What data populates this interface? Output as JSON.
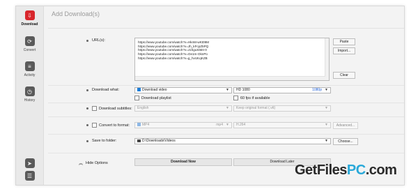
{
  "title": "Add Download(s)",
  "sidebar": {
    "items": [
      {
        "label": "Download",
        "icon": "download-icon"
      },
      {
        "label": "Convert",
        "icon": "convert-icon"
      },
      {
        "label": "Activity",
        "icon": "activity-icon"
      },
      {
        "label": "History",
        "icon": "history-icon"
      }
    ]
  },
  "url": {
    "label": "URL(s):",
    "lines": [
      "https://www.youtube.com/watch?v=HknM-wKt09M",
      "https://www.youtube.com/watch?v=Jh_kFcpZ5PQ",
      "https://www.youtube.com/watch?v=J1hguSiM4-0",
      "https://www.youtube.com/watch?v=Oe1m-OknPo",
      "https://www.youtube.com/watch?v=g_hvUKqKZB"
    ],
    "paste": "Paste",
    "import": "Import...",
    "clear": "Clear"
  },
  "download_what": {
    "label": "Download what:",
    "value": "Download video",
    "quality": "HD 1080",
    "quality_right": "1080p",
    "playlist": "Download playlist",
    "fps": "60 fps if available"
  },
  "subtitles": {
    "label": "Download subtitles:",
    "language": "English",
    "format": "Keep original format (.vtt)"
  },
  "convert": {
    "label": "Convert to format:",
    "format": "MP4",
    "format_right": "mp4",
    "codec": "H.264",
    "advanced": "Advanced..."
  },
  "save": {
    "label": "Save to folder:",
    "path": "D:\\Downloads\\Videos",
    "choose": "Choose..."
  },
  "footer": {
    "hide": "Hide Options",
    "now": "Download Now",
    "later": "Download Later"
  },
  "watermark": {
    "main": "GetFiles",
    "pc": "PC",
    "dot": ".com"
  }
}
